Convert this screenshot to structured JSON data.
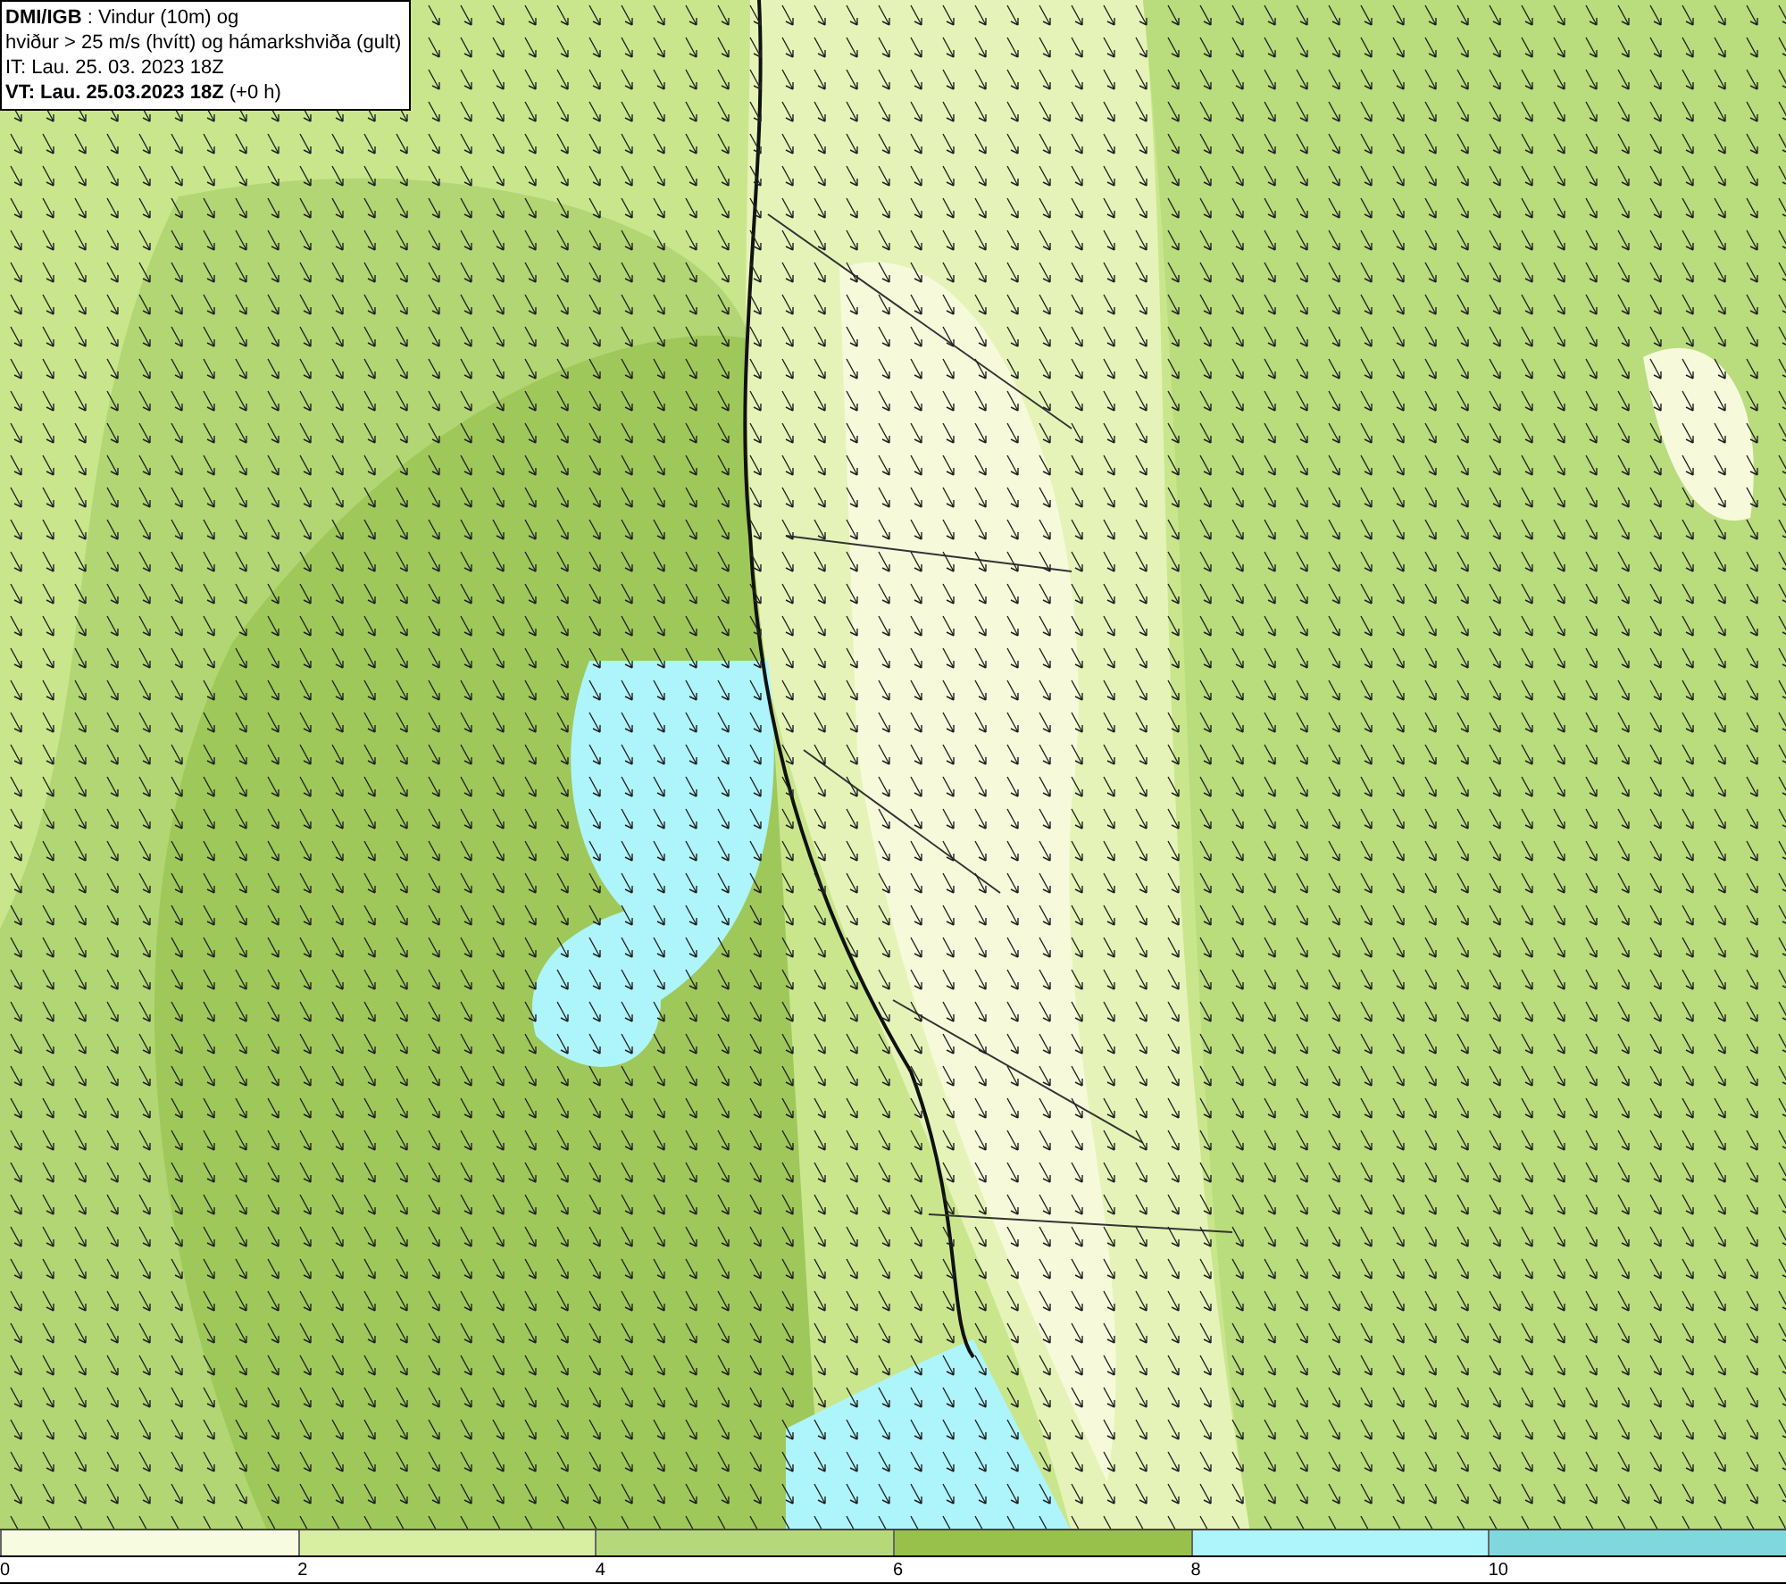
{
  "info_box": {
    "lines": [
      "**DMI/IGB** : Vindur (10m) og",
      "hviður > 25 m/s (hvítt) og hámarkshviða (gult)",
      "IT: Lau. 25. 03. 2023 18Z",
      "**VT: Lau. 25.03.2023 18Z** (+0 h)"
    ]
  },
  "legend": {
    "segments": [
      {
        "label": "0",
        "color": "#f7fbe0"
      },
      {
        "label": "2",
        "color": "#d8eea0"
      },
      {
        "label": "4",
        "color": "#b5d97a"
      },
      {
        "label": "6",
        "color": "#97c14a"
      },
      {
        "label": "8",
        "color": "#aef4fb"
      },
      {
        "label": "10",
        "color": "#80d8dc"
      }
    ]
  }
}
